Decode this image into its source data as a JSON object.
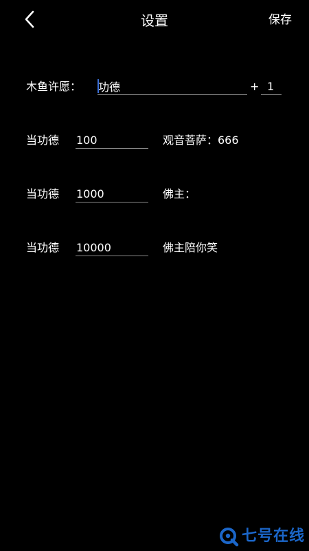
{
  "header": {
    "title": "设置",
    "save_label": "保存",
    "back_icon": "chevron-left-icon"
  },
  "wish": {
    "label": "木鱼许愿：",
    "text_value": "功德",
    "plus_label": "+",
    "increment_value": "1"
  },
  "rules": [
    {
      "label": "当功德",
      "threshold": "100",
      "message": "观音菩萨：666"
    },
    {
      "label": "当功德",
      "threshold": "1000",
      "message": "佛主："
    },
    {
      "label": "当功德",
      "threshold": "10000",
      "message": "佛主陪你笑"
    }
  ],
  "watermark": {
    "text": "七号在线",
    "icon": "search-q-logo",
    "color": "#1b66c9"
  },
  "colors": {
    "background": "#000000",
    "text": "#ffffff",
    "underline": "#8a8a8a",
    "caret": "#3b6fd8"
  }
}
